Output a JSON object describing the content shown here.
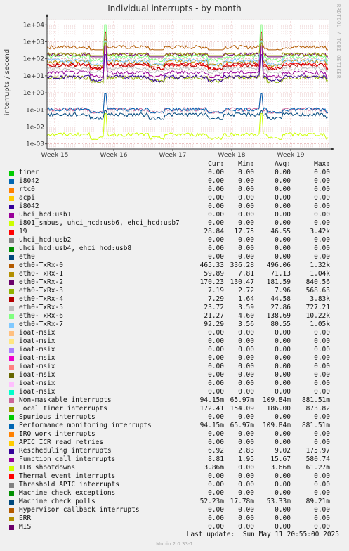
{
  "title": "Individual interrupts - by month",
  "ylabel": "interrupts / second",
  "watermark": "RRDTOOL / TOBI OETIKER",
  "last_update": "Last update:  Sun May 11 20:55:00 2025",
  "footer": "Munin 2.0.33-1",
  "legend_headers": {
    "cur": "Cur:",
    "min": "Min:",
    "avg": "Avg:",
    "max": "Max:"
  },
  "chart_data": {
    "type": "line",
    "title": "Individual interrupts - by month",
    "ylabel": "interrupts / second",
    "xlabel": "",
    "yscale": "log",
    "ylim": [
      0.0005,
      20000
    ],
    "yticks": [
      0.001,
      0.01,
      0.1,
      1,
      10,
      100,
      1000,
      10000
    ],
    "ytick_labels": [
      "1e-03",
      "1e-02",
      "1e-01",
      "1e+00",
      "1e+01",
      "1e+02",
      "1e+03",
      "1e+04"
    ],
    "xticks": [
      "Week 15",
      "Week 16",
      "Week 17",
      "Week 18",
      "Week 19"
    ],
    "grid": true,
    "series": [
      {
        "name": "timer",
        "color": "#00cc00",
        "cur": "0.00",
        "min": "0.00",
        "avg": "0.00",
        "max": "0.00"
      },
      {
        "name": "i8042",
        "color": "#0066b3",
        "cur": "0.00",
        "min": "0.00",
        "avg": "0.00",
        "max": "0.00"
      },
      {
        "name": "rtc0",
        "color": "#ff8000",
        "cur": "0.00",
        "min": "0.00",
        "avg": "0.00",
        "max": "0.00"
      },
      {
        "name": "acpi",
        "color": "#ffcc00",
        "cur": "0.00",
        "min": "0.00",
        "avg": "0.00",
        "max": "0.00"
      },
      {
        "name": "i8042",
        "color": "#330099",
        "cur": "0.00",
        "min": "0.00",
        "avg": "0.00",
        "max": "0.00"
      },
      {
        "name": "uhci_hcd:usb1",
        "color": "#990099",
        "cur": "0.00",
        "min": "0.00",
        "avg": "0.00",
        "max": "0.00"
      },
      {
        "name": "i801_smbus, uhci_hcd:usb6, ehci_hcd:usb7",
        "color": "#ccff00",
        "cur": "0.00",
        "min": "0.00",
        "avg": "0.00",
        "max": "0.00"
      },
      {
        "name": "19",
        "color": "#ff0000",
        "cur": "28.84",
        "min": "17.75",
        "avg": "46.55",
        "max": "3.42k"
      },
      {
        "name": "uhci_hcd:usb2",
        "color": "#808080",
        "cur": "0.00",
        "min": "0.00",
        "avg": "0.00",
        "max": "0.00"
      },
      {
        "name": "uhci_hcd:usb4, ehci_hcd:usb8",
        "color": "#008f00",
        "cur": "0.00",
        "min": "0.00",
        "avg": "0.00",
        "max": "0.00"
      },
      {
        "name": "eth0",
        "color": "#00487d",
        "cur": "0.00",
        "min": "0.00",
        "avg": "0.00",
        "max": "0.00"
      },
      {
        "name": "eth0-TxRx-0",
        "color": "#b35a00",
        "cur": "465.33",
        "min": "336.28",
        "avg": "496.06",
        "max": "1.32k"
      },
      {
        "name": "eth0-TxRx-1",
        "color": "#b38f00",
        "cur": "59.89",
        "min": "7.81",
        "avg": "71.13",
        "max": "1.04k"
      },
      {
        "name": "eth0-TxRx-2",
        "color": "#6b006b",
        "cur": "170.23",
        "min": "130.47",
        "avg": "181.59",
        "max": "840.56"
      },
      {
        "name": "eth0-TxRx-3",
        "color": "#8fb300",
        "cur": "7.19",
        "min": "2.72",
        "avg": "7.96",
        "max": "568.63"
      },
      {
        "name": "eth0-TxRx-4",
        "color": "#b30000",
        "cur": "7.29",
        "min": "1.64",
        "avg": "44.58",
        "max": "3.83k"
      },
      {
        "name": "eth0-TxRx-5",
        "color": "#bebebe",
        "cur": "23.72",
        "min": "3.59",
        "avg": "27.86",
        "max": "727.21"
      },
      {
        "name": "eth0-TxRx-6",
        "color": "#80ff80",
        "cur": "21.27",
        "min": "4.60",
        "avg": "138.69",
        "max": "10.22k"
      },
      {
        "name": "eth0-TxRx-7",
        "color": "#80c9ff",
        "cur": "92.29",
        "min": "3.56",
        "avg": "80.55",
        "max": "1.05k"
      },
      {
        "name": "ioat-msix",
        "color": "#ffc080",
        "cur": "0.00",
        "min": "0.00",
        "avg": "0.00",
        "max": "0.00"
      },
      {
        "name": "ioat-msix",
        "color": "#ffe680",
        "cur": "0.00",
        "min": "0.00",
        "avg": "0.00",
        "max": "0.00"
      },
      {
        "name": "ioat-msix",
        "color": "#aa80ff",
        "cur": "0.00",
        "min": "0.00",
        "avg": "0.00",
        "max": "0.00"
      },
      {
        "name": "ioat-msix",
        "color": "#ee00cc",
        "cur": "0.00",
        "min": "0.00",
        "avg": "0.00",
        "max": "0.00"
      },
      {
        "name": "ioat-msix",
        "color": "#ff8080",
        "cur": "0.00",
        "min": "0.00",
        "avg": "0.00",
        "max": "0.00"
      },
      {
        "name": "ioat-msix",
        "color": "#666600",
        "cur": "0.00",
        "min": "0.00",
        "avg": "0.00",
        "max": "0.00"
      },
      {
        "name": "ioat-msix",
        "color": "#ffbfff",
        "cur": "0.00",
        "min": "0.00",
        "avg": "0.00",
        "max": "0.00"
      },
      {
        "name": "ioat-msix",
        "color": "#00ffcc",
        "cur": "0.00",
        "min": "0.00",
        "avg": "0.00",
        "max": "0.00"
      },
      {
        "name": "Non-maskable interrupts",
        "color": "#cc6699",
        "cur": "94.15m",
        "min": "65.97m",
        "avg": "109.84m",
        "max": "881.51m"
      },
      {
        "name": "Local timer interrupts",
        "color": "#999900",
        "cur": "172.41",
        "min": "154.09",
        "avg": "186.00",
        "max": "873.82"
      },
      {
        "name": "Spurious interrupts",
        "color": "#00cc00",
        "cur": "0.00",
        "min": "0.00",
        "avg": "0.00",
        "max": "0.00"
      },
      {
        "name": "Performance monitoring interrupts",
        "color": "#0066b3",
        "cur": "94.15m",
        "min": "65.97m",
        "avg": "109.84m",
        "max": "881.51m"
      },
      {
        "name": "IRQ work interrupts",
        "color": "#ff8000",
        "cur": "0.00",
        "min": "0.00",
        "avg": "0.00",
        "max": "0.00"
      },
      {
        "name": "APIC ICR read retries",
        "color": "#ffcc00",
        "cur": "0.00",
        "min": "0.00",
        "avg": "0.00",
        "max": "0.00"
      },
      {
        "name": "Rescheduling interrupts",
        "color": "#330099",
        "cur": "6.92",
        "min": "2.83",
        "avg": "9.02",
        "max": "175.97"
      },
      {
        "name": "Function call interrupts",
        "color": "#990099",
        "cur": "8.81",
        "min": "1.95",
        "avg": "15.67",
        "max": "580.74"
      },
      {
        "name": "TLB shootdowns",
        "color": "#ccff00",
        "cur": "3.86m",
        "min": "0.00",
        "avg": "3.66m",
        "max": "61.27m"
      },
      {
        "name": "Thermal event interrupts",
        "color": "#ff0000",
        "cur": "0.00",
        "min": "0.00",
        "avg": "0.00",
        "max": "0.00"
      },
      {
        "name": "Threshold APIC interrupts",
        "color": "#808080",
        "cur": "0.00",
        "min": "0.00",
        "avg": "0.00",
        "max": "0.00"
      },
      {
        "name": "Machine check exceptions",
        "color": "#008f00",
        "cur": "0.00",
        "min": "0.00",
        "avg": "0.00",
        "max": "0.00"
      },
      {
        "name": "Machine check polls",
        "color": "#00487d",
        "cur": "52.23m",
        "min": "17.78m",
        "avg": "53.33m",
        "max": "89.21m"
      },
      {
        "name": "Hypervisor callback interrupts",
        "color": "#b35a00",
        "cur": "0.00",
        "min": "0.00",
        "avg": "0.00",
        "max": "0.00"
      },
      {
        "name": "ERR",
        "color": "#b38f00",
        "cur": "0.00",
        "min": "0.00",
        "avg": "0.00",
        "max": "0.00"
      },
      {
        "name": "MIS",
        "color": "#6b006b",
        "cur": "0.00",
        "min": "0.00",
        "avg": "0.00",
        "max": "0.00"
      }
    ]
  }
}
